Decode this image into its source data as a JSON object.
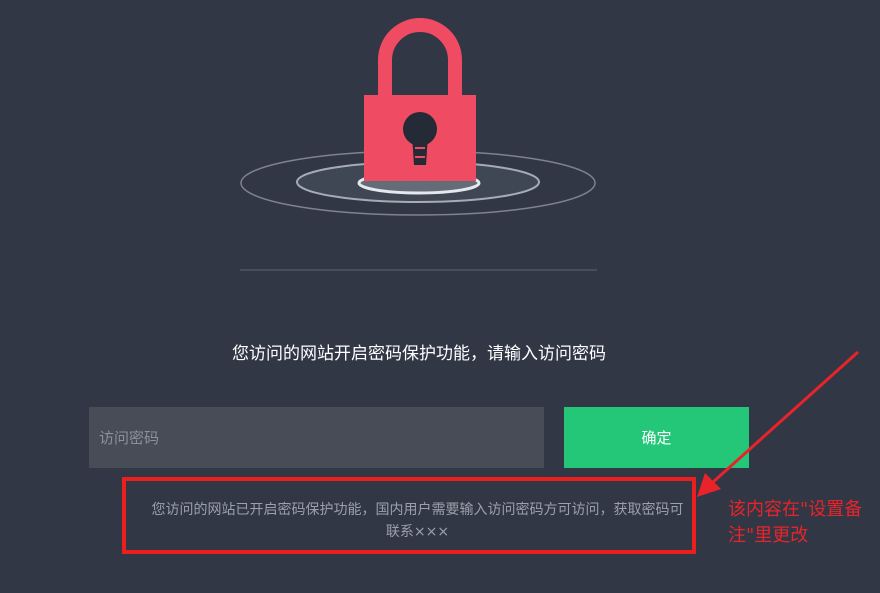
{
  "prompt": {
    "text": "您访问的网站开启密码保护功能，请输入访问密码"
  },
  "form": {
    "password_placeholder": "访问密码",
    "password_value": "",
    "confirm_label": "确定"
  },
  "note": {
    "text": "您访问的网站已开启密码保护功能，国内用户需要输入访问密码方可访问，获取密码可联系×××"
  },
  "annotation": {
    "text": "该内容在\"设置备注\"里更改"
  },
  "colors": {
    "background": "#313745",
    "lock": "#ef4b62",
    "confirm_button": "#24c677",
    "input_background": "#474c56",
    "annotation_red": "#e8242a"
  },
  "icons": {
    "lock": "padlock-icon"
  }
}
